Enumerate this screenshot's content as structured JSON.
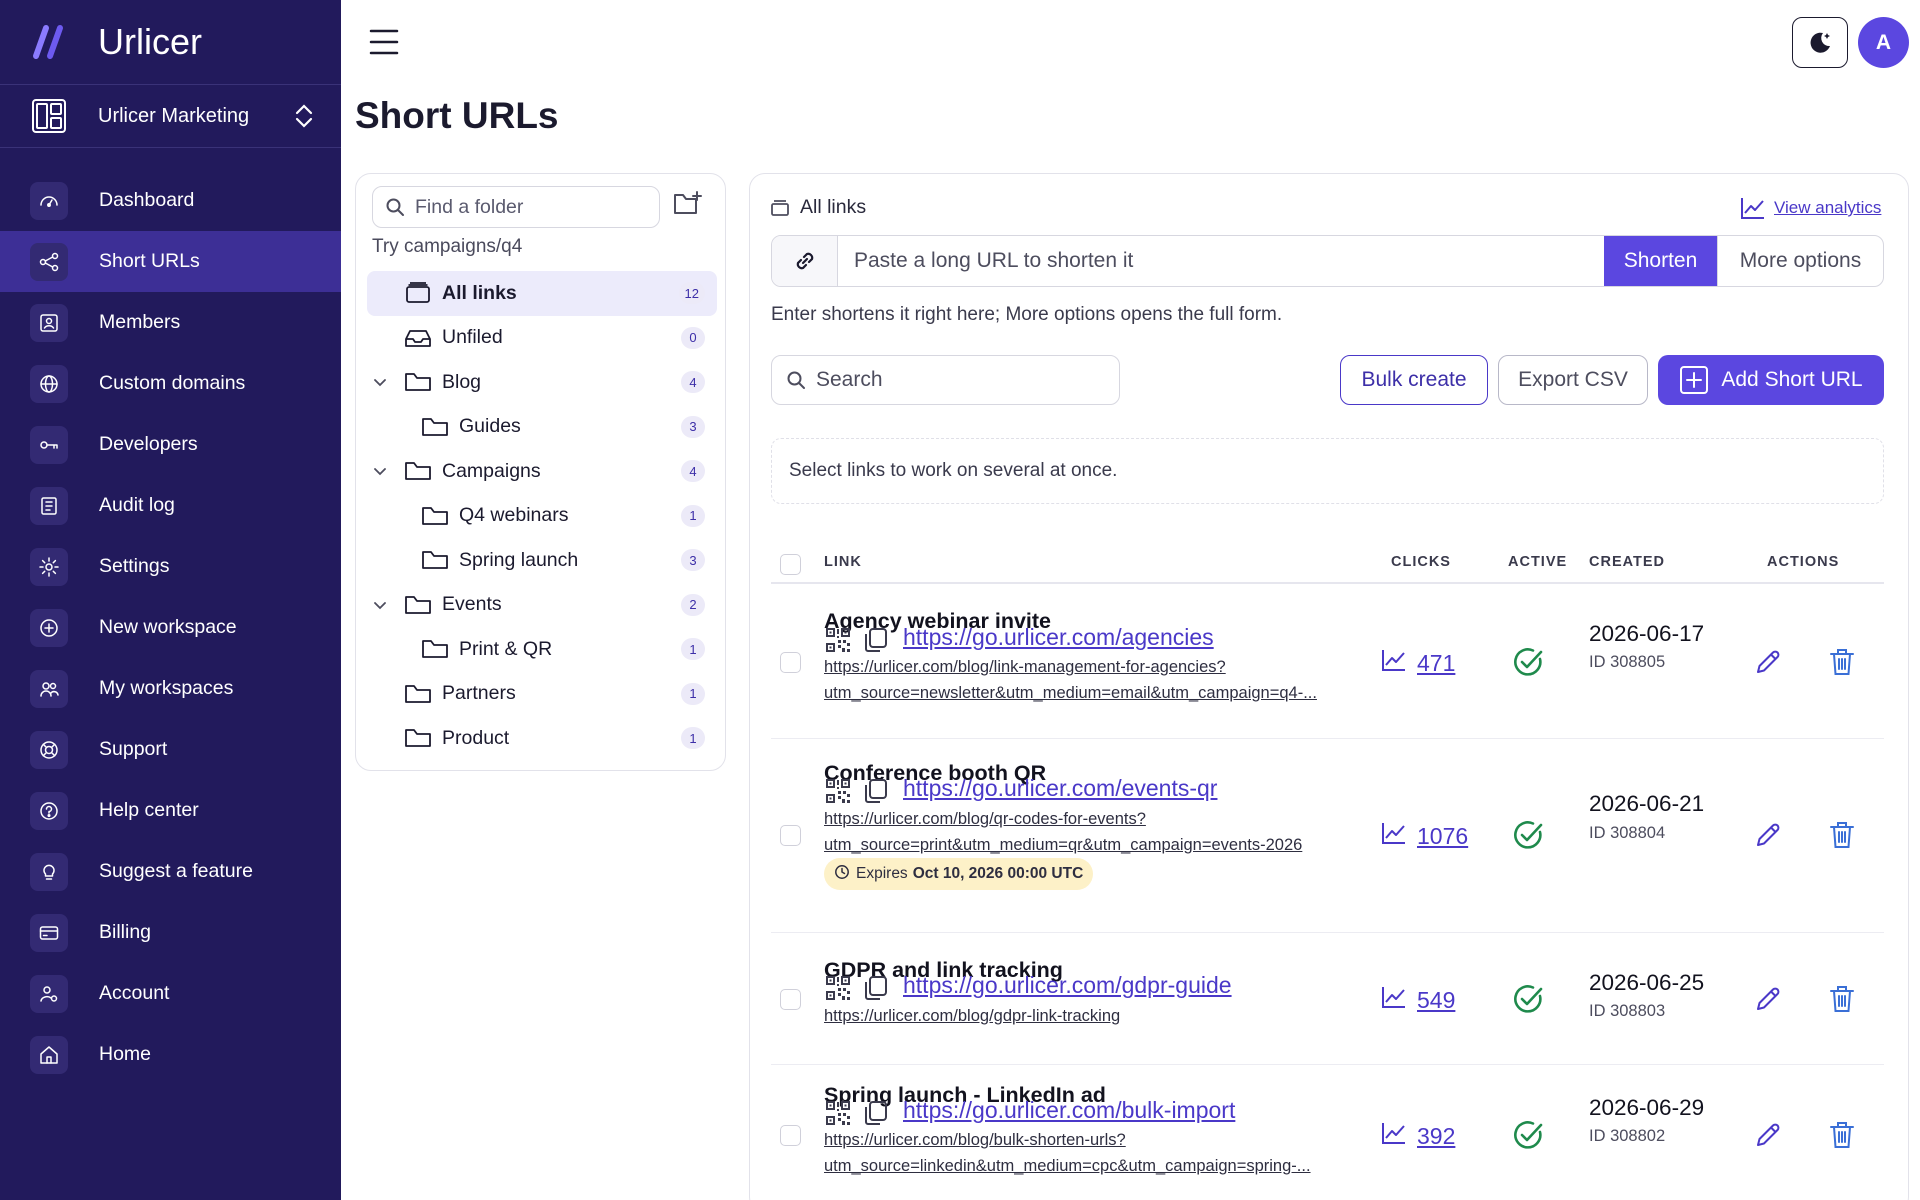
{
  "app": {
    "name": "Urlicer"
  },
  "workspace": {
    "name": "Urlicer Marketing"
  },
  "nav": [
    {
      "label": "Dashboard",
      "icon": "gauge-icon"
    },
    {
      "label": "Short URLs",
      "icon": "share-icon",
      "active": true
    },
    {
      "label": "Members",
      "icon": "member-card-icon"
    },
    {
      "label": "Custom domains",
      "icon": "globe-icon"
    },
    {
      "label": "Developers",
      "icon": "key-icon"
    },
    {
      "label": "Audit log",
      "icon": "list-doc-icon"
    },
    {
      "label": "Settings",
      "icon": "gear-icon"
    },
    {
      "label": "New workspace",
      "icon": "plus-circle-icon"
    },
    {
      "label": "My workspaces",
      "icon": "users-icon"
    },
    {
      "label": "Support",
      "icon": "lifebuoy-icon"
    },
    {
      "label": "Help center",
      "icon": "question-icon"
    },
    {
      "label": "Suggest a feature",
      "icon": "lightbulb-icon"
    },
    {
      "label": "Billing",
      "icon": "credit-card-icon"
    },
    {
      "label": "Account",
      "icon": "user-gear-icon"
    },
    {
      "label": "Home",
      "icon": "home-icon"
    }
  ],
  "topbar": {
    "avatar_initial": "A"
  },
  "page": {
    "title": "Short URLs"
  },
  "folders": {
    "search_placeholder": "Find a folder",
    "hint": "Try campaigns/q4",
    "items": [
      {
        "label": "All links",
        "count": "12",
        "level": 0,
        "active": true,
        "icon": "tray"
      },
      {
        "label": "Unfiled",
        "count": "0",
        "level": 0,
        "icon": "inbox"
      },
      {
        "label": "Blog",
        "count": "4",
        "level": 0,
        "expandable": true
      },
      {
        "label": "Guides",
        "count": "3",
        "level": 1
      },
      {
        "label": "Campaigns",
        "count": "4",
        "level": 0,
        "expandable": true
      },
      {
        "label": "Q4 webinars",
        "count": "1",
        "level": 1
      },
      {
        "label": "Spring launch",
        "count": "3",
        "level": 1
      },
      {
        "label": "Events",
        "count": "2",
        "level": 0,
        "expandable": true
      },
      {
        "label": "Print & QR",
        "count": "1",
        "level": 1
      },
      {
        "label": "Partners",
        "count": "1",
        "level": 0
      },
      {
        "label": "Product",
        "count": "1",
        "level": 0
      }
    ]
  },
  "main": {
    "section_label": "All links",
    "view_analytics": "View analytics",
    "shorten_placeholder": "Paste a long URL to shorten it",
    "shorten_label": "Shorten",
    "more_options_label": "More options",
    "shorten_help": "Enter shortens it right here; More options opens the full form.",
    "search_placeholder": "Search",
    "bulk_create": "Bulk create",
    "export_csv": "Export CSV",
    "add_short_url": "Add Short URL",
    "select_hint": "Select links to work on several at once.",
    "columns": {
      "link": "LINK",
      "clicks": "CLICKS",
      "active": "ACTIVE",
      "created": "CREATED",
      "actions": "ACTIONS"
    }
  },
  "links": [
    {
      "title": "Agency webinar invite",
      "short_url": "https://go.urlicer.com/agencies",
      "long_url_1": "https://urlicer.com/blog/link-management-for-agencies?",
      "long_url_2": "utm_source=newsletter&utm_medium=email&utm_campaign=q4-...",
      "clicks": "471",
      "created": "2026-06-17",
      "id": "ID 308805"
    },
    {
      "title": "Conference booth QR",
      "short_url": "https://go.urlicer.com/events-qr",
      "long_url_1": "https://urlicer.com/blog/qr-codes-for-events?",
      "long_url_2": "utm_source=print&utm_medium=qr&utm_campaign=events-2026",
      "expires_label": "Expires",
      "expires_value": "Oct 10, 2026 00:00 UTC",
      "clicks": "1076",
      "created": "2026-06-21",
      "id": "ID 308804"
    },
    {
      "title": "GDPR and link tracking",
      "short_url": "https://go.urlicer.com/gdpr-guide",
      "long_url_1": "https://urlicer.com/blog/gdpr-link-tracking",
      "clicks": "549",
      "created": "2026-06-25",
      "id": "ID 308803"
    },
    {
      "title": "Spring launch - LinkedIn ad",
      "short_url": "https://go.urlicer.com/bulk-import",
      "long_url_1": "https://urlicer.com/blog/bulk-shorten-urls?",
      "long_url_2": "utm_source=linkedin&utm_medium=cpc&utm_campaign=spring-...",
      "clicks": "392",
      "created": "2026-06-29",
      "id": "ID 308802"
    }
  ],
  "colors": {
    "sidebar_bg": "#221a5c",
    "sidebar_active": "#3d2f96",
    "accent": "#5b47e0",
    "success": "#1f8a4c",
    "danger": "#3a6fd6"
  }
}
